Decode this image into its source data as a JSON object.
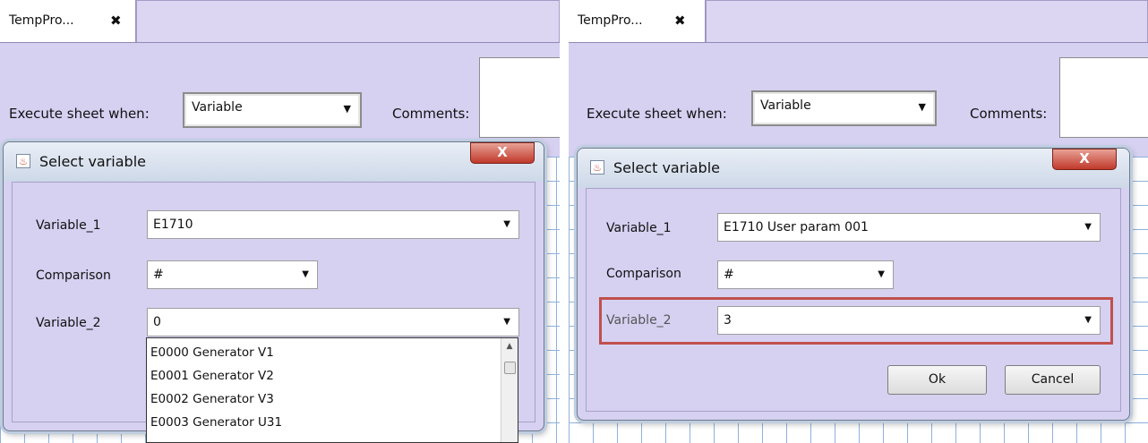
{
  "left": {
    "tab": {
      "label": "TempPro...",
      "close": "✖"
    },
    "execute": {
      "label": "Execute sheet when:",
      "value": "Variable"
    },
    "comments_label": "Comments:",
    "dialog": {
      "title": "Select variable",
      "close": "X",
      "variable1": {
        "label": "Variable_1",
        "value": "E1710"
      },
      "comparison": {
        "label": "Comparison",
        "value": "#"
      },
      "variable2": {
        "label": "Variable_2",
        "value": "0"
      },
      "dropdown": [
        "E0000 Generator V1",
        "E0001 Generator V2",
        "E0002 Generator V3",
        "E0003 Generator U31"
      ]
    }
  },
  "right": {
    "tab": {
      "label": "TempPro...",
      "close": "✖"
    },
    "execute": {
      "label": "Execute sheet when:",
      "value": "Variable"
    },
    "comments_label": "Comments:",
    "dialog": {
      "title": "Select variable",
      "close": "X",
      "variable1": {
        "label": "Variable_1",
        "value": "E1710 User param 001"
      },
      "comparison": {
        "label": "Comparison",
        "value": "#"
      },
      "variable2": {
        "label": "Variable_2",
        "value": "3"
      },
      "ok_label": "Ok",
      "cancel_label": "Cancel"
    }
  },
  "colors": {
    "workspace": "#d6d0f1",
    "highlight": "#c0504d",
    "close_button": "#c0392b",
    "grid_lines": "#8fb2dc"
  },
  "icons": {
    "dropdown_arrow": "▼",
    "java_app": "java-icon",
    "scroll_up": "▲"
  }
}
